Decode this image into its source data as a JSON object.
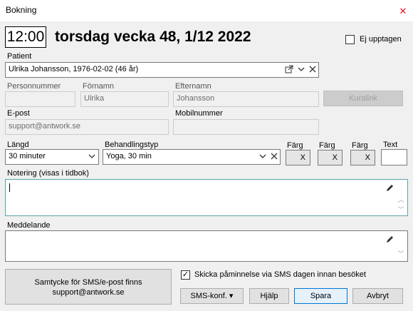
{
  "window": {
    "title": "Bokning"
  },
  "header": {
    "time": "12:00",
    "date_title": "torsdag vecka 48, 1/12 2022",
    "not_busy_label": "Ej upptagen",
    "not_busy_checked": false
  },
  "patient": {
    "label": "Patient",
    "value": "Ulrika Johansson, 1976-02-02 (46 år)"
  },
  "person": {
    "personnummer_label": "Personnummer",
    "personnummer_value": "",
    "fornamn_label": "Förnamn",
    "fornamn_value": "Ulrika",
    "efternamn_label": "Efternamn",
    "efternamn_value": "Johansson",
    "kuralink_label": "Kuralink"
  },
  "contact": {
    "email_label": "E-post",
    "email_value": "support@antwork.se",
    "mobile_label": "Mobilnummer",
    "mobile_value": ""
  },
  "booking": {
    "length_label": "Längd",
    "length_value": "30 minuter",
    "treatment_label": "Behandlingstyp",
    "treatment_value": "Yoga, 30 min",
    "color_label": "Färg",
    "color_x": "X",
    "text_label": "Text",
    "text_value": ""
  },
  "notes": {
    "note_label": "Notering (visas i tidbok)",
    "note_value": "",
    "message_label": "Meddelande",
    "message_value": ""
  },
  "footer": {
    "consent_line1": "Samtycke för SMS/e-post finns",
    "consent_line2": "support@antwork.se",
    "sms_reminder_label": "Skicka påminnelse via SMS dagen innan besöket",
    "sms_reminder_checked": true,
    "sms_conf_label": "SMS-konf. ▾",
    "help_label": "Hjälp",
    "save_label": "Spara",
    "cancel_label": "Avbryt"
  }
}
